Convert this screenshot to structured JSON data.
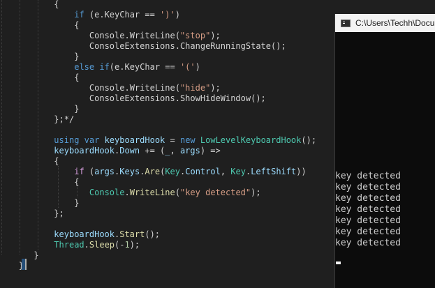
{
  "editor": {
    "lines": [
      {
        "indent": 10,
        "tokens": [
          {
            "t": "{",
            "c": "pun"
          }
        ]
      },
      {
        "indent": 14,
        "tokens": [
          {
            "t": "if",
            "c": "kw"
          },
          {
            "t": " (e.KeyChar == ",
            "c": "pun"
          },
          {
            "t": "')'",
            "c": "str"
          },
          {
            "t": ")",
            "c": "pun"
          }
        ]
      },
      {
        "indent": 14,
        "tokens": [
          {
            "t": "{",
            "c": "pun"
          }
        ]
      },
      {
        "indent": 17,
        "tokens": [
          {
            "t": "Console.WriteLine(",
            "c": "pun"
          },
          {
            "t": "\"stop\"",
            "c": "str"
          },
          {
            "t": ");",
            "c": "pun"
          }
        ]
      },
      {
        "indent": 17,
        "tokens": [
          {
            "t": "ConsoleExtensions.ChangeRunningState();",
            "c": "pun"
          }
        ]
      },
      {
        "indent": 14,
        "tokens": [
          {
            "t": "}",
            "c": "pun"
          }
        ]
      },
      {
        "indent": 14,
        "tokens": [
          {
            "t": "else if",
            "c": "kw"
          },
          {
            "t": "(e.KeyChar == ",
            "c": "pun"
          },
          {
            "t": "'('",
            "c": "str"
          },
          {
            "t": ")",
            "c": "pun"
          }
        ]
      },
      {
        "indent": 14,
        "tokens": [
          {
            "t": "{",
            "c": "pun"
          }
        ]
      },
      {
        "indent": 17,
        "tokens": [
          {
            "t": "Console.WriteLine(",
            "c": "pun"
          },
          {
            "t": "\"hide\"",
            "c": "str"
          },
          {
            "t": ");",
            "c": "pun"
          }
        ]
      },
      {
        "indent": 17,
        "tokens": [
          {
            "t": "ConsoleExtensions.ShowHideWindow();",
            "c": "pun"
          }
        ]
      },
      {
        "indent": 14,
        "tokens": [
          {
            "t": "}",
            "c": "pun"
          }
        ]
      },
      {
        "indent": 10,
        "tokens": [
          {
            "t": "};*/",
            "c": "pun"
          }
        ]
      },
      {
        "indent": 0,
        "tokens": []
      },
      {
        "indent": 10,
        "tokens": [
          {
            "t": "using",
            "c": "kw"
          },
          {
            "t": " ",
            "c": "pun"
          },
          {
            "t": "var",
            "c": "kw"
          },
          {
            "t": " ",
            "c": "pun"
          },
          {
            "t": "keyboardHook",
            "c": "var"
          },
          {
            "t": " = ",
            "c": "pun"
          },
          {
            "t": "new",
            "c": "kw"
          },
          {
            "t": " ",
            "c": "pun"
          },
          {
            "t": "LowLevelKeyboardHook",
            "c": "type"
          },
          {
            "t": "();",
            "c": "pun"
          }
        ]
      },
      {
        "indent": 10,
        "tokens": [
          {
            "t": "keyboardHook",
            "c": "var"
          },
          {
            "t": ".",
            "c": "pun"
          },
          {
            "t": "Down",
            "c": "var"
          },
          {
            "t": " += (",
            "c": "pun"
          },
          {
            "t": "_",
            "c": "var"
          },
          {
            "t": ", ",
            "c": "pun"
          },
          {
            "t": "args",
            "c": "var"
          },
          {
            "t": ") =>",
            "c": "pun"
          }
        ]
      },
      {
        "indent": 10,
        "tokens": [
          {
            "t": "{",
            "c": "pun"
          }
        ]
      },
      {
        "indent": 14,
        "tokens": [
          {
            "t": "if",
            "c": "ctl"
          },
          {
            "t": " (",
            "c": "pun"
          },
          {
            "t": "args",
            "c": "var"
          },
          {
            "t": ".",
            "c": "pun"
          },
          {
            "t": "Keys",
            "c": "var"
          },
          {
            "t": ".",
            "c": "pun"
          },
          {
            "t": "Are",
            "c": "fn"
          },
          {
            "t": "(",
            "c": "pun"
          },
          {
            "t": "Key",
            "c": "type"
          },
          {
            "t": ".",
            "c": "pun"
          },
          {
            "t": "Control",
            "c": "var"
          },
          {
            "t": ", ",
            "c": "pun"
          },
          {
            "t": "Key",
            "c": "type"
          },
          {
            "t": ".",
            "c": "pun"
          },
          {
            "t": "LeftShift",
            "c": "var"
          },
          {
            "t": "))",
            "c": "pun"
          }
        ]
      },
      {
        "indent": 14,
        "tokens": [
          {
            "t": "{",
            "c": "pun"
          }
        ]
      },
      {
        "indent": 17,
        "tokens": [
          {
            "t": "Console",
            "c": "type"
          },
          {
            "t": ".",
            "c": "pun"
          },
          {
            "t": "WriteLine",
            "c": "fn"
          },
          {
            "t": "(",
            "c": "pun"
          },
          {
            "t": "\"key detected\"",
            "c": "str"
          },
          {
            "t": ");",
            "c": "pun"
          }
        ]
      },
      {
        "indent": 14,
        "tokens": [
          {
            "t": "}",
            "c": "pun"
          }
        ]
      },
      {
        "indent": 10,
        "tokens": [
          {
            "t": "};",
            "c": "pun"
          }
        ]
      },
      {
        "indent": 0,
        "tokens": []
      },
      {
        "indent": 10,
        "tokens": [
          {
            "t": "keyboardHook",
            "c": "var"
          },
          {
            "t": ".",
            "c": "pun"
          },
          {
            "t": "Start",
            "c": "fn"
          },
          {
            "t": "();",
            "c": "pun"
          }
        ]
      },
      {
        "indent": 10,
        "tokens": [
          {
            "t": "Thread",
            "c": "type"
          },
          {
            "t": ".",
            "c": "pun"
          },
          {
            "t": "Sleep",
            "c": "fn"
          },
          {
            "t": "(-",
            "c": "pun"
          },
          {
            "t": "1",
            "c": "num"
          },
          {
            "t": ");",
            "c": "pun"
          }
        ]
      },
      {
        "indent": 6,
        "tokens": [
          {
            "t": "}",
            "c": "pun"
          }
        ]
      },
      {
        "indent": 3,
        "tokens": [
          {
            "t": "}",
            "c": "pun"
          }
        ]
      }
    ]
  },
  "console": {
    "title": "C:\\Users\\Techh\\Documents",
    "output_lines": [
      "key detected",
      "key detected",
      "key detected",
      "key detected",
      "key detected",
      "key detected",
      "key detected"
    ]
  },
  "colors": {
    "kw": "#569cd6",
    "ctl": "#d8a0df",
    "str": "#d69d85",
    "var": "#9cdcfe",
    "type": "#4ec9b0",
    "fn": "#dcdcaa",
    "num": "#b5cea8",
    "pun": "#d4d4d4",
    "comment": "#57a64a",
    "editor_bg": "#1f1f1f",
    "console_bg": "#0c0c0c",
    "console_text": "#cccccc"
  }
}
